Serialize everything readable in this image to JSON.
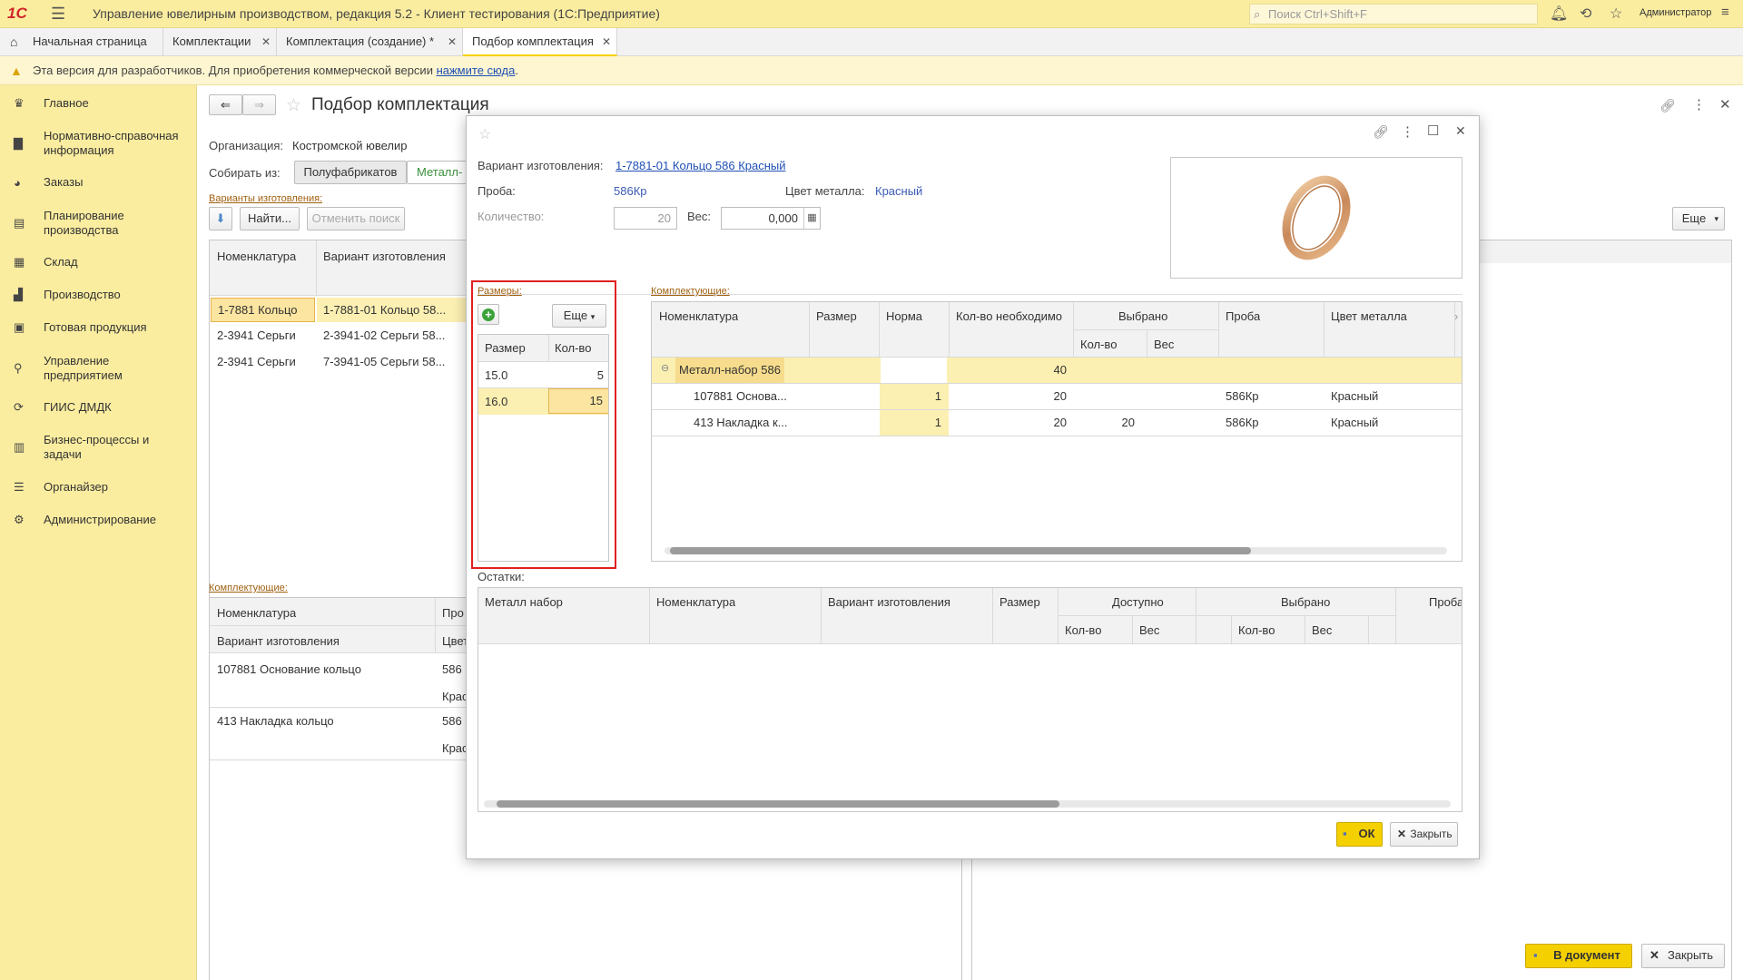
{
  "titlebar": {
    "logo": "1С",
    "title": "Управление ювелирным производством, редакция 5.2  - Клиент тестирования (1С:Предприятие)",
    "search_placeholder": "Поиск Ctrl+Shift+F",
    "user": "Администратор"
  },
  "tabs": [
    {
      "label": "Начальная страница"
    },
    {
      "label": "Комплектации"
    },
    {
      "label": "Комплектация (создание) *"
    },
    {
      "label": "Подбор комплектация"
    }
  ],
  "warning": {
    "text": "Эта версия для разработчиков. Для приобретения коммерческой версии ",
    "link": "нажмите сюда",
    "tail": "."
  },
  "sidebar": {
    "items": [
      {
        "label": "Главное",
        "icon": "crown-icon"
      },
      {
        "label": "Нормативно-справочная информация",
        "icon": "book-icon"
      },
      {
        "label": "Заказы",
        "icon": "pie-icon"
      },
      {
        "label": "Планирование производства",
        "icon": "clipboard-icon"
      },
      {
        "label": "Склад",
        "icon": "grid-icon"
      },
      {
        "label": "Производство",
        "icon": "factory-icon"
      },
      {
        "label": "Готовая продукция",
        "icon": "bag-icon"
      },
      {
        "label": "Управление предприятием",
        "icon": "org-icon"
      },
      {
        "label": "ГИИС ДМДК",
        "icon": "sync-icon"
      },
      {
        "label": "Бизнес-процессы и задачи",
        "icon": "doc-icon"
      },
      {
        "label": "Органайзер",
        "icon": "list-icon"
      },
      {
        "label": "Администрирование",
        "icon": "gear-icon"
      }
    ]
  },
  "form": {
    "title": "Подбор комплектация",
    "org_label": "Организация:",
    "org_value": "Костромской ювелир",
    "collect_label": "Собирать из:",
    "collect_options": [
      "Полуфабрикатов",
      "Металл-"
    ],
    "variants_caption": "Варианты изготовления:",
    "find_button": "Найти...",
    "cancel_search_button": "Отменить поиск",
    "more_button": "Еще",
    "variants_headers": [
      "Номенклатура",
      "Вариант изготовления"
    ],
    "variants_rows": [
      [
        "1-7881 Кольцо",
        "1-7881-01 Кольцо 58..."
      ],
      [
        "2-3941 Серьги",
        "2-3941-02 Серьги 58..."
      ],
      [
        "2-3941 Серьги",
        "7-3941-05 Серьги 58..."
      ]
    ],
    "components_caption": "Комплектующие:",
    "components_headers": [
      "Номенклатура",
      "Про",
      "Вариант изготовления",
      "Цвет"
    ],
    "components_rows": [
      [
        "107881 Основание кольцо",
        "586",
        "Крас"
      ],
      [
        "413 Накладка кольцо",
        "586",
        "Крас"
      ]
    ],
    "to_document_button": "В документ",
    "close_button": "Закрыть"
  },
  "modal": {
    "variant_label": "Вариант изготовления:",
    "variant_value": "1-7881-01 Кольцо 586 Красный",
    "proba_label": "Проба:",
    "proba_value": "586Кр",
    "color_label": "Цвет металла:",
    "color_value": "Красный",
    "qty_label": "Количество:",
    "qty_value": "20",
    "weight_label": "Вес:",
    "weight_value": "0,000",
    "sizes_caption": "Размеры:",
    "sizes_more": "Еще",
    "sizes_headers": [
      "Размер",
      "Кол-во"
    ],
    "sizes_rows": [
      [
        "15.0",
        "5"
      ],
      [
        "16.0",
        "15"
      ]
    ],
    "components_caption": "Комплектующие:",
    "comp_headers": {
      "nom": "Номенклатура",
      "size": "Размер",
      "norm": "Норма",
      "needed": "Кол-во  необходимо",
      "selected": "Выбрано",
      "sel_qty": "Кол-во",
      "sel_weight": "Вес",
      "proba": "Проба",
      "color": "Цвет металла"
    },
    "comp_group": {
      "name": "Металл-набор 586",
      "needed": "40"
    },
    "comp_rows": [
      {
        "nom": "107881 Основа...",
        "norm": "1",
        "needed": "20",
        "sel_qty": "",
        "proba": "586Кр",
        "color": "Красный"
      },
      {
        "nom": "413 Накладка к...",
        "norm": "1",
        "needed": "20",
        "sel_qty": "20",
        "proba": "586Кр",
        "color": "Красный"
      }
    ],
    "rest_caption": "Остатки:",
    "rest_headers": {
      "metal": "Металл набор",
      "nom": "Номенклатура",
      "variant": "Вариант изготовления",
      "size": "Размер",
      "available": "Доступно",
      "selected": "Выбрано",
      "qty": "Кол-во",
      "weight": "Вес",
      "proba": "Проба"
    },
    "ok_button": "ОК",
    "close_button": "Закрыть"
  },
  "colors": {
    "accent_yellow": "#fbeda0",
    "highlight_red": "#e02020",
    "link_blue": "#1f4fb5"
  }
}
